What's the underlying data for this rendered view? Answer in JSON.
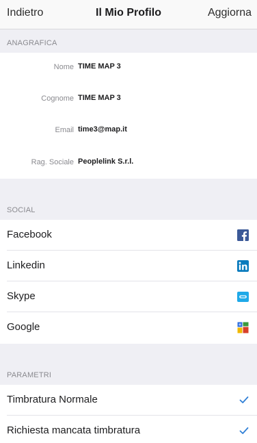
{
  "nav": {
    "back_label": "Indietro",
    "title": "Il Mio Profilo",
    "refresh_label": "Aggiorna"
  },
  "anagrafica": {
    "header": "ANAGRAFICA",
    "fields": [
      {
        "label": "Nome",
        "value": "TIME MAP 3"
      },
      {
        "label": "Cognome",
        "value": "TIME MAP 3"
      },
      {
        "label": "Email",
        "value": "time3@map.it"
      },
      {
        "label": "Rag. Sociale",
        "value": "Peoplelink S.r.l."
      }
    ]
  },
  "social": {
    "header": "SOCIAL",
    "items": [
      {
        "label": "Facebook",
        "icon": "facebook-icon"
      },
      {
        "label": "Linkedin",
        "icon": "linkedin-icon"
      },
      {
        "label": "Skype",
        "icon": "skype-icon"
      },
      {
        "label": "Google",
        "icon": "google-icon"
      }
    ]
  },
  "parametri": {
    "header": "PARAMETRI",
    "items": [
      {
        "label": "Timbratura Normale",
        "checked": true
      },
      {
        "label": "Richiesta mancata timbratura",
        "checked": true
      }
    ]
  },
  "colors": {
    "accent": "#2f7fd6",
    "section_bg": "#efeff4",
    "facebook": "#3b5998",
    "linkedin": "#0a7bbd",
    "skype": "#1fa9e8"
  }
}
